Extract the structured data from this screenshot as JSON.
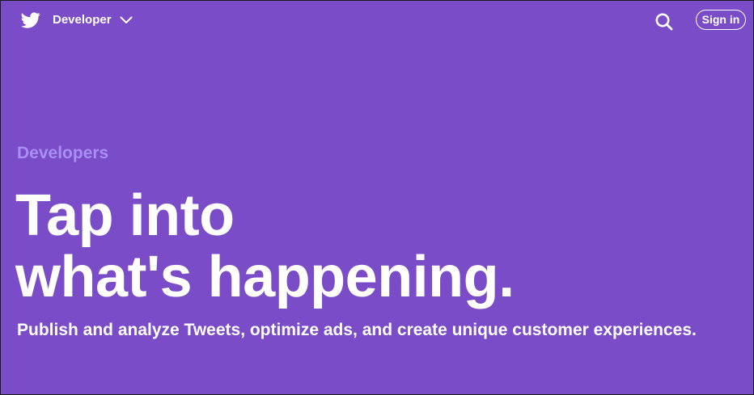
{
  "header": {
    "brand_label": "Developer",
    "brand_icon": "twitter-bird-icon",
    "menu_icon": "chevron-down-icon",
    "search_icon": "search-icon",
    "signin_label": "Sign in"
  },
  "hero": {
    "eyebrow": "Developers",
    "headline_line1": "Tap into",
    "headline_line2": "what's happening.",
    "subtext": "Publish and analyze Tweets, optimize ads, and create unique customer experiences."
  },
  "colors": {
    "background": "#7b4cc7",
    "eyebrow": "#a88ff4",
    "text": "#ffffff"
  }
}
